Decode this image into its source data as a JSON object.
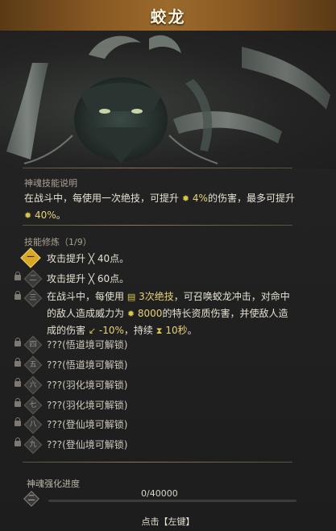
{
  "title": "蛟龙",
  "section_desc": {
    "title": "神魂技能说明",
    "line1_pre": "在战斗中，每使用一次绝技，可提升",
    "line1_val": "4%",
    "line1_post": "的伤害，最多可提升",
    "line2_val": "40%",
    "line2_post": "。"
  },
  "section_skills": {
    "title": "技能修炼（1/9）",
    "rows": [
      {
        "num": "一",
        "text": "攻击提升 ╳ 40点。",
        "locked": false,
        "active": true
      },
      {
        "num": "二",
        "text": "攻击提升 ╳ 60点。",
        "locked": true,
        "active": false
      },
      {
        "num": "三",
        "text": "",
        "locked": true,
        "active": false
      },
      {
        "num": "四",
        "text": "???(悟道境可解锁)",
        "locked": true,
        "active": false
      },
      {
        "num": "五",
        "text": "???(悟道境可解锁)",
        "locked": true,
        "active": false
      },
      {
        "num": "六",
        "text": "???(羽化境可解锁)",
        "locked": true,
        "active": false
      },
      {
        "num": "七",
        "text": "???(羽化境可解锁)",
        "locked": true,
        "active": false
      },
      {
        "num": "八",
        "text": "???(登仙境可解锁)",
        "locked": true,
        "active": false
      },
      {
        "num": "九",
        "text": "???(登仙境可解锁)",
        "locked": true,
        "active": false
      }
    ],
    "row3": {
      "l1_pre": "在战斗中，每使用",
      "l1_val": "3次绝技",
      "l1_post": "，可召唤蛟龙冲击，对命中",
      "l2_pre": "的敌人造成威力为",
      "l2_val": "8000",
      "l2_post": "的特长资质伤害，并使敌人造",
      "l3_pre": "成的伤害",
      "l3_val": "-10%",
      "l3_mid": "，持续",
      "l3_val2": "10秒",
      "l3_post": "。"
    }
  },
  "progress": {
    "title": "神魂强化进度",
    "level": "二",
    "current": 0,
    "max": 40000,
    "text": "0/40000",
    "fraction": 0
  },
  "hint": "点击【左键】",
  "colors": {
    "accent": "#e8d27a",
    "title_bar": "#8a5a24",
    "active_badge": "#d9a926"
  }
}
